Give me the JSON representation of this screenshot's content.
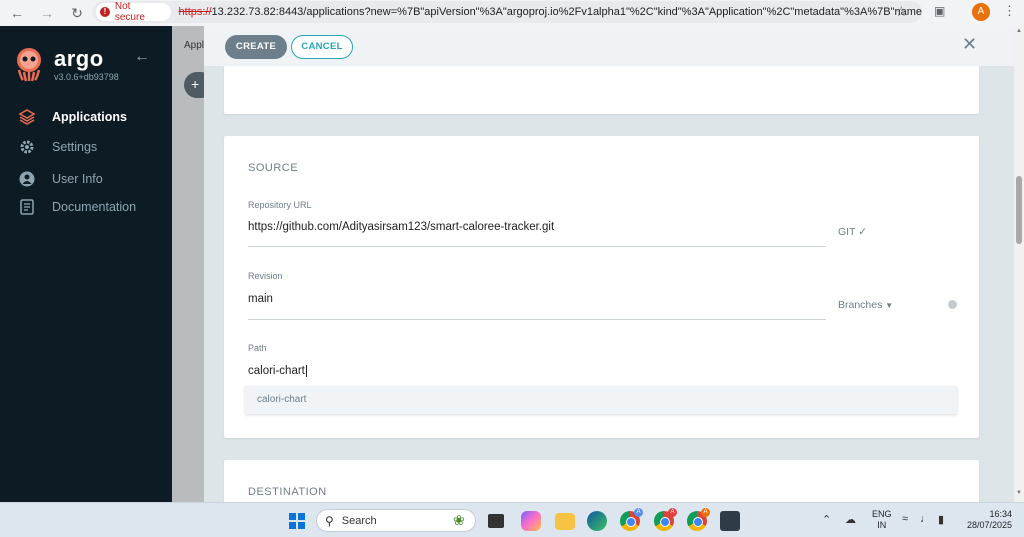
{
  "browser": {
    "security_label": "Not secure",
    "url_scheme": "https://",
    "url_rest": "13.232.73.82:8443/applications?new=%7B\"apiVersion\"%3A\"argoproj.io%2Fv1alpha1\"%2C\"kind\"%3A\"Application\"%2C\"metadata\"%3A%7B\"name\"...",
    "profile_initial": "A"
  },
  "sidebar": {
    "brand": "argo",
    "version": "v3.0.6+db93798",
    "items": [
      {
        "label": "Applications",
        "icon": "layers-icon",
        "active": true
      },
      {
        "label": "Settings",
        "icon": "gear-icon",
        "active": false
      },
      {
        "label": "User Info",
        "icon": "user-icon",
        "active": false
      },
      {
        "label": "Documentation",
        "icon": "document-icon",
        "active": false
      }
    ]
  },
  "backdrop": {
    "text": "Appl"
  },
  "panel": {
    "create_label": "CREATE",
    "cancel_label": "CANCEL",
    "source": {
      "title": "SOURCE",
      "repo_label": "Repository URL",
      "repo_value": "https://github.com/Adityasirsam123/smart-caloree-tracker.git",
      "repo_type": "GIT",
      "revision_label": "Revision",
      "revision_value": "main",
      "revision_mode": "Branches",
      "path_label": "Path",
      "path_value": "calori-chart",
      "suggestion": "calori-chart"
    },
    "destination": {
      "title": "DESTINATION"
    }
  },
  "taskbar": {
    "search_label": "Search",
    "lang_line1": "ENG",
    "lang_line2": "IN",
    "time": "16:34",
    "date": "28/07/2025"
  },
  "colors": {
    "sidebar_bg": "#0d1c24",
    "accent": "#26a6b8",
    "create_btn": "#6d7f8b"
  }
}
